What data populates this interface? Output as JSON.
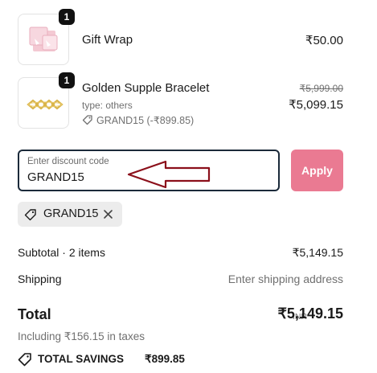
{
  "items": [
    {
      "name": "Gift Wrap",
      "quantity": "1",
      "price": "₹50.00",
      "thumb_icon": "gift-wrap-image"
    },
    {
      "name": "Golden Supple Bracelet",
      "quantity": "1",
      "type": "type: others",
      "discount_tag": "GRAND15 (-₹899.85)",
      "original_price": "₹5,999.00",
      "price": "₹5,099.15",
      "thumb_icon": "bracelet-image"
    }
  ],
  "discount": {
    "label": "Enter discount code",
    "value": "GRAND15",
    "apply_label": "Apply",
    "applied_code": "GRAND15"
  },
  "summary": {
    "subtotal_label": "Subtotal · 2 items",
    "subtotal_value": "₹5,149.15",
    "shipping_label": "Shipping",
    "shipping_value": "Enter shipping address",
    "total_label": "Total",
    "currency": "INR",
    "total_value": "₹5,149.15",
    "taxes": "Including ₹156.15 in taxes",
    "savings_label": "TOTAL SAVINGS",
    "savings_value": "₹899.85"
  },
  "colors": {
    "apply_button": "#ea7a92",
    "field_border": "#1b2a3a",
    "annotation_arrow": "#8b0f1a"
  }
}
